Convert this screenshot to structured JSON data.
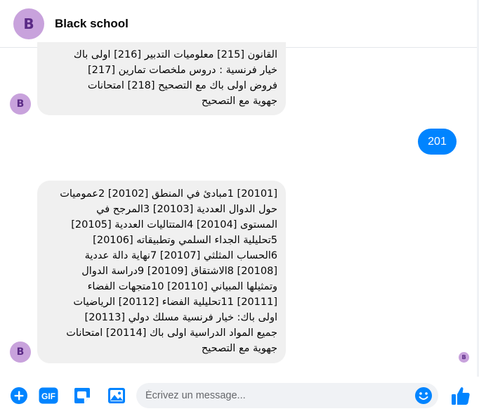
{
  "header": {
    "avatar_letter": "B",
    "title": "Black school"
  },
  "messages": [
    {
      "direction": "incoming",
      "avatar_letter": "B",
      "text": "القانون [215] معلوميات التدبير [216] اولى باك\nخيار فرنسية : دروس ملخصات تمارين [217]\nفروض اولى باك مع التصحيح [218] امتحانات\nجهوية مع التصحيح"
    },
    {
      "direction": "outgoing",
      "text": "201"
    },
    {
      "direction": "incoming",
      "avatar_letter": "B",
      "text": "[20101] 1مبادئ في المنطق [20102] 2عموميات\nحول الدوال العددية [20103] 3المرجح في\nالمستوى [20104] 4المتتاليات العددية [20105]\n5تحليلية الجداء السلمي وتطبيقاته [20106]\n6الحساب المثلثي [20107] 7نهاية دالة عددية\n[20108] 8الاشتقاق [20109] 9دراسة الدوال\nوتمثيلها المبياني [20110] 10متجهات الفضاء\n[20111] 11تحليلية الفضاء [20112] الرياضيات\nاولى باك: خيار فرنسية مسلك دولي [20113]\nجميع المواد الدراسية اولى باك [20114] امتحانات\nجهوية مع التصحيح"
    }
  ],
  "seen_avatar_letter": "B",
  "composer": {
    "placeholder": "Écrivez un message...",
    "value": "",
    "gif_label": "GIF"
  },
  "colors": {
    "accent": "#0084ff",
    "avatar_bg": "#c8a2dc",
    "bubble_incoming": "#f0f0f0"
  },
  "icons": [
    "plus-circle-icon",
    "gif-icon",
    "sticker-icon",
    "image-icon",
    "emoji-icon",
    "thumbs-up-icon"
  ]
}
